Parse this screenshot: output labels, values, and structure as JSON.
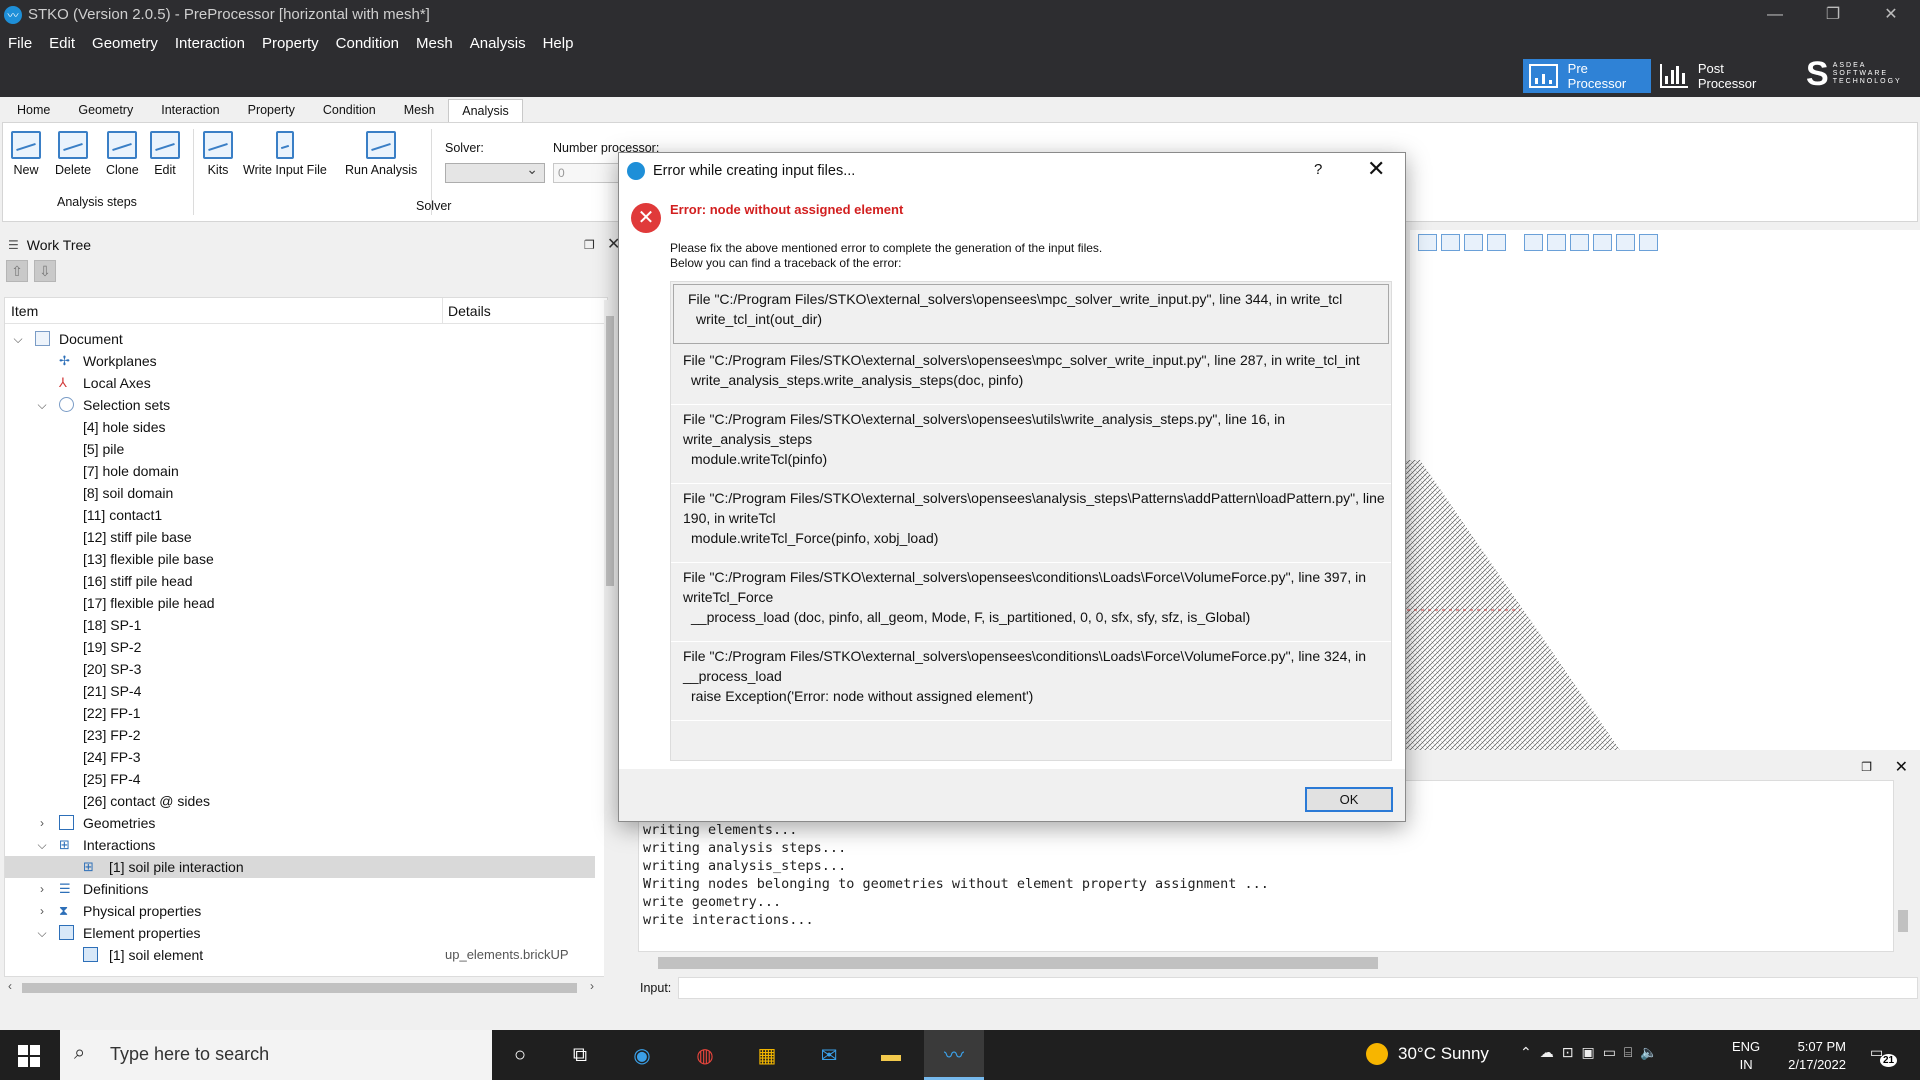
{
  "window": {
    "title": "STKO (Version 2.0.5) - PreProcessor [horizontal  with mesh*]",
    "controls": [
      "—",
      "❐",
      "✕"
    ]
  },
  "menu": [
    "File",
    "Edit",
    "Geometry",
    "Interaction",
    "Property",
    "Condition",
    "Mesh",
    "Analysis",
    "Help"
  ],
  "modes": {
    "pre": "Pre Processor",
    "post": "Post Processor"
  },
  "brand": {
    "line1": "ASDEA",
    "line2": "SOFTWARE",
    "line3": "TECHNOLOGY"
  },
  "ribbon": {
    "tabs": [
      "Home",
      "Geometry",
      "Interaction",
      "Property",
      "Condition",
      "Mesh",
      "Analysis"
    ],
    "active_tab": "Analysis",
    "analysis_steps": {
      "new": "New",
      "delete": "Delete",
      "clone": "Clone",
      "edit": "Edit",
      "group": "Analysis steps"
    },
    "solver_group": {
      "kits": "Kits",
      "write_input": "Write Input File",
      "run": "Run Analysis",
      "group": "Solver"
    },
    "solver_label": "Solver:",
    "numproc_label": "Number processor:",
    "numproc_value": "0"
  },
  "worktree": {
    "title": "Work Tree",
    "col_item": "Item",
    "col_details": "Details",
    "nodes": {
      "document": "Document",
      "workplanes": "Workplanes",
      "local_axes": "Local Axes",
      "selection_sets": "Selection sets",
      "sets": [
        "[4] hole sides",
        "[5] pile",
        "[7] hole domain",
        "[8] soil domain",
        "[11] contact1",
        "[12] stiff pile base",
        "[13] flexible pile base",
        "[16] stiff pile head",
        "[17] flexible pile head",
        "[18] SP-1",
        "[19] SP-2",
        "[20] SP-3",
        "[21] SP-4",
        "[22] FP-1",
        "[23] FP-2",
        "[24] FP-3",
        "[25] FP-4",
        "[26] contact @ sides"
      ],
      "geometries": "Geometries",
      "interactions": "Interactions",
      "interaction_1": "[1] soil pile interaction",
      "definitions": "Definitions",
      "physical_properties": "Physical properties",
      "element_properties": "Element properties",
      "element_1": "[1] soil element",
      "element_1_detail": "up_elements.brickUP"
    }
  },
  "console": {
    "lines": "writing elements...\nwriting analysis steps...\nwriting analysis_steps...\nWriting nodes belonging to geometries without element property assignment ...\nwrite geometry...\nwrite interactions...",
    "input_label": "Input:"
  },
  "dialog": {
    "title": "Error while creating input files...",
    "help": "?",
    "close": "✕",
    "error_heading": "Error: node without assigned element",
    "msg1": "Please fix the above mentioned error to complete the generation of the input files.",
    "msg2": "Below you can find a traceback of the error:",
    "frames": [
      {
        "file": "File \"C:/Program Files/STKO\\external_solvers\\opensees\\mpc_solver_write_input.py\", line 344, in write_tcl",
        "code": "write_tcl_int(out_dir)"
      },
      {
        "file": "File \"C:/Program Files/STKO\\external_solvers\\opensees\\mpc_solver_write_input.py\", line 287, in write_tcl_int",
        "code": "write_analysis_steps.write_analysis_steps(doc, pinfo)"
      },
      {
        "file": "File \"C:/Program Files/STKO\\external_solvers\\opensees\\utils\\write_analysis_steps.py\", line 16, in write_analysis_steps",
        "code": "module.writeTcl(pinfo)"
      },
      {
        "file": "File \"C:/Program Files/STKO\\external_solvers\\opensees\\analysis_steps\\Patterns\\addPattern\\loadPattern.py\", line 190, in writeTcl",
        "code": "module.writeTcl_Force(pinfo, xobj_load)"
      },
      {
        "file": "File \"C:/Program Files/STKO\\external_solvers\\opensees\\conditions\\Loads\\Force\\VolumeForce.py\", line 397, in writeTcl_Force",
        "code": "__process_load (doc, pinfo, all_geom, Mode, F, is_partitioned, 0, 0, sfx, sfy, sfz, is_Global)"
      },
      {
        "file": "File \"C:/Program Files/STKO\\external_solvers\\opensees\\conditions\\Loads\\Force\\VolumeForce.py\", line 324, in __process_load",
        "code": "raise Exception('Error: node without assigned element')"
      }
    ],
    "ok": "OK"
  },
  "taskbar": {
    "search_placeholder": "Type here to search",
    "weather": "30°C  Sunny",
    "lang1": "ENG",
    "lang2": "IN",
    "time": "5:07 PM",
    "date": "2/17/2022",
    "notifications": "21"
  },
  "colors": {
    "accent": "#2f82d6",
    "error": "#d21f1f",
    "titlebar": "#2d2d30"
  }
}
